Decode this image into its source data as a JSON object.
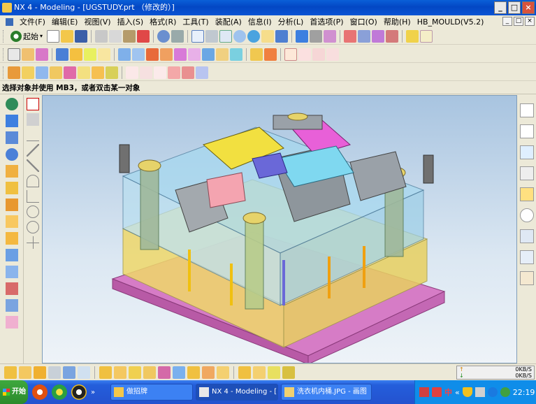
{
  "window": {
    "title": "NX 4 - Modeling - [UGSTUDY.prt （修改的）]"
  },
  "window_buttons": [
    "_",
    "□",
    "×"
  ],
  "menu": [
    "文件(F)",
    "编辑(E)",
    "视图(V)",
    "插入(S)",
    "格式(R)",
    "工具(T)",
    "装配(A)",
    "信息(I)",
    "分析(L)",
    "首选项(P)",
    "窗口(O)",
    "帮助(H)",
    "HB_MOULD(V5.2)"
  ],
  "menu_buttons": [
    "_",
    "□",
    "×"
  ],
  "toolbar": {
    "start_label": "起始"
  },
  "prompt": "选择对象并使用 MB3，或者双击某一对象",
  "network": {
    "up_label": "0KB/S",
    "down_label": "0KB/S"
  },
  "taskbar": {
    "start_label": "开始",
    "tasks": [
      "做招牌",
      "NX 4 - Modeling - [...",
      "洗衣机内桶.JPG - 画图"
    ],
    "ime_label": "中",
    "time": "22:19"
  },
  "colors": {
    "titlebar": "#0347c4",
    "mould_yellow": "#f2e17a",
    "mould_magenta": "#e878d8",
    "mould_cyan": "#7fd6ee",
    "mould_gray": "#9aa1a8"
  }
}
